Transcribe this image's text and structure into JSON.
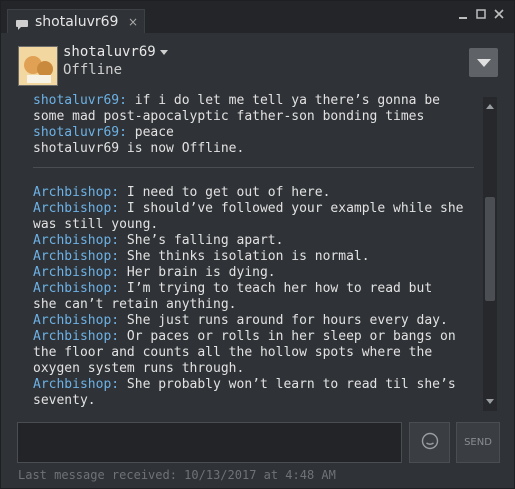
{
  "tab": {
    "title": "shotaluvr69",
    "close_label": "×"
  },
  "window": {
    "minimize_icon": "minimize-icon",
    "maximize_icon": "maximize-icon",
    "close_icon": "close-icon"
  },
  "header": {
    "friend_name": "shotaluvr69",
    "status": "Offline"
  },
  "messages": [
    {
      "name": "shotaluvr69:",
      "text": " if i do let me tell ya there’s gonna be",
      "style": "blue"
    },
    {
      "name": "",
      "text": "some mad post-apocalyptic father-son bonding times",
      "style": "plain"
    },
    {
      "name": "shotaluvr69:",
      "text": " peace",
      "style": "blue"
    },
    {
      "name": "",
      "text": "shotaluvr69 is now Offline.",
      "style": "plain"
    },
    {
      "name": "Archbishop:",
      "text": " I need to get out of here.",
      "style": "blue"
    },
    {
      "name": "Archbishop:",
      "text": " I should’ve followed your example while she",
      "style": "blue"
    },
    {
      "name": "",
      "text": "was still young.",
      "style": "plain"
    },
    {
      "name": "Archbishop:",
      "text": " She’s falling apart.",
      "style": "blue"
    },
    {
      "name": "Archbishop:",
      "text": " She thinks isolation is normal.",
      "style": "blue"
    },
    {
      "name": "Archbishop:",
      "text": " Her brain is dying.",
      "style": "blue"
    },
    {
      "name": "Archbishop:",
      "text": " I’m trying to teach her how to read but",
      "style": "blue"
    },
    {
      "name": "",
      "text": "she can’t retain anything.",
      "style": "plain"
    },
    {
      "name": "Archbishop:",
      "text": " She just runs around for hours every day.",
      "style": "blue"
    },
    {
      "name": "Archbishop:",
      "text": " Or paces or rolls in her sleep or bangs on",
      "style": "blue"
    },
    {
      "name": "",
      "text": "the floor and counts all the hollow spots where the",
      "style": "plain"
    },
    {
      "name": "",
      "text": "oxygen system runs through.",
      "style": "plain"
    },
    {
      "name": "Archbishop:",
      "text": " She probably won’t learn to read til she’s",
      "style": "blue"
    },
    {
      "name": "",
      "text": "seventy.",
      "style": "plain"
    }
  ],
  "input": {
    "value": ""
  },
  "send_label": "SEND",
  "footer": "Last message received: 10/13/2017 at 4:48 AM"
}
